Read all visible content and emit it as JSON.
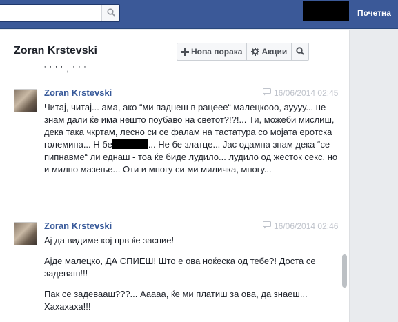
{
  "header": {
    "search_placeholder": "",
    "home_link": "Почетна"
  },
  "conversation": {
    "title": "Zoran Krstevski",
    "buttons": {
      "new_message": "Нова порака",
      "actions": "Акции"
    },
    "partial_previous_line": "' '  ' '  ,  '  ' '"
  },
  "messages": [
    {
      "author": "Zoran Krstevski",
      "timestamp": "16/06/2014 02:45",
      "text_part1": "Читај, читај... ама, ако “ми паднеш в рацеее“ малецкооо, ауууу... не знам дали ќе има нешто поубаво на светот?!?!... Ти, можеби мислиш, дека така чкртам, лесно си се фалам на тастатура со мојата еротска големина... Н бе",
      "text_part2": "... Не бе злат­це... Јас одамна знам дека “се пипнавме“ ли еднаш - тоа ќе биде лудило... лудило од жесток секс, но и милно мазење... Оти и многу си ми миличка, многу..."
    },
    {
      "author": "Zoran Krstevski",
      "timestamp": "16/06/2014 02:46",
      "paragraphs": [
        "Ај да видиме кој прв ќе заспие!",
        "Ајде малецко, ДА СПИЕШ! Што е ова ноќеска од тебе?! Доста се задеваш!!!",
        "Пак се задевааш???... Ааааа, ќе ми платиш за ова, да знаеш... Хахахаха!!!"
      ]
    }
  ],
  "icons": {
    "search": "search-icon",
    "plus": "plus-icon",
    "gear": "gear-icon",
    "chat": "chat-bubble-icon"
  },
  "colors": {
    "topbar": "#3b5998",
    "author_link": "#365899",
    "timestamp": "#c0c4cc"
  }
}
